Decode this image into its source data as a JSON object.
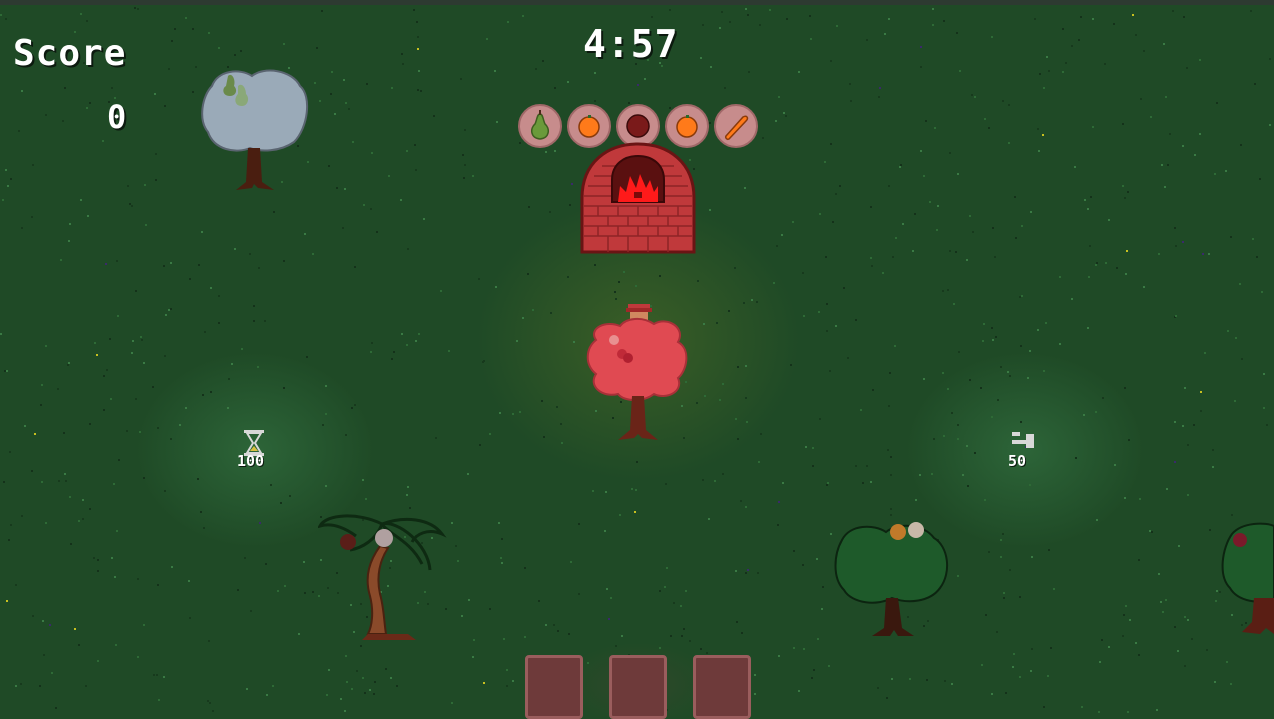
{
  "hud": {
    "score_label": "Score",
    "score_value": "0",
    "timer": "4:57"
  },
  "orders": [
    {
      "icon": "pear-icon",
      "color": "#6a9a3a"
    },
    {
      "icon": "orange-icon",
      "color": "#ff7a1a"
    },
    {
      "icon": "plum-icon",
      "color": "#7a1a1a"
    },
    {
      "icon": "orange-icon",
      "color": "#ff7a1a"
    },
    {
      "icon": "carrot-icon",
      "color": "#ff7a1a"
    }
  ],
  "pickups": {
    "hourglass_cost": "100",
    "hammer_cost": "50"
  },
  "inventory_slots": 3,
  "colors": {
    "grass": "#1f4a26",
    "oven": "#c0393b",
    "fire": "#ff1a1a",
    "slot": "#6e3a3a",
    "slot_border": "#9a5d5d"
  }
}
